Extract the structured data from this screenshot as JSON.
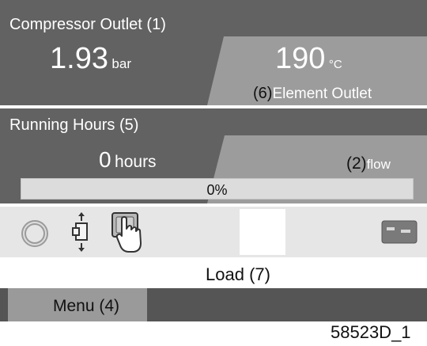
{
  "colors": {
    "dark_panel": "#626262",
    "light_panel": "#9c9c9c",
    "icon_strip": "#e6e6e6",
    "menu_bar": "#555555",
    "menu_button": "#9a9a9a",
    "page": "#ffffff"
  },
  "panel1": {
    "title": "Compressor Outlet",
    "title_ref": "(1)",
    "pressure_value": "1.93",
    "pressure_unit": "bar",
    "temperature_value": "190",
    "temperature_unit": "°C",
    "temperature_ref": "(6)",
    "temperature_label": "Element Outlet"
  },
  "panel2": {
    "title": "Running Hours",
    "title_ref": "(5)",
    "hours_value": "0",
    "hours_unit": "hours",
    "flow_ref": "(2)",
    "flow_label": "flow",
    "progress_text": "0%",
    "progress_fraction": 0
  },
  "icons": {
    "status": "circle-status-icon",
    "unload": "arrows-stack-icon",
    "manual": "hand-pointer-icon",
    "card": "card-icon"
  },
  "status": {
    "text": "Load",
    "ref": "(7)"
  },
  "menu": {
    "label": "Menu",
    "ref": "(4)"
  },
  "figure_id": "58523D_1"
}
